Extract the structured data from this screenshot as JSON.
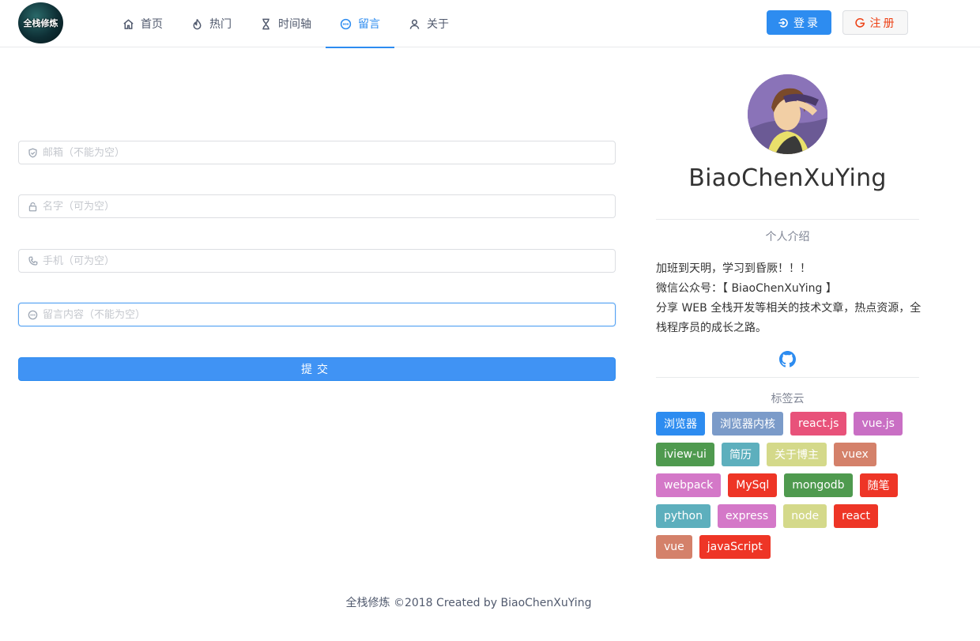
{
  "header": {
    "logo_text": "全栈修炼",
    "nav": [
      {
        "label": "首页",
        "icon": "home-icon"
      },
      {
        "label": "热门",
        "icon": "flame-icon"
      },
      {
        "label": "时间轴",
        "icon": "hourglass-icon"
      },
      {
        "label": "留言",
        "icon": "message-icon",
        "active": true
      },
      {
        "label": "关于",
        "icon": "user-icon"
      }
    ],
    "login_label": "登录",
    "register_label": "注册"
  },
  "form": {
    "email_placeholder": "邮箱（不能为空）",
    "name_placeholder": "名字（可为空）",
    "phone_placeholder": "手机（可为空）",
    "message_placeholder": "留言内容（不能为空）",
    "submit_label": "提交"
  },
  "profile": {
    "name": "BiaoChenXuYing",
    "intro_title": "个人介绍",
    "intro_lines": [
      "加班到天明，学习到昏厥！！！",
      "微信公众号：【 BiaoChenXuYing 】",
      "分享 WEB 全栈开发等相关的技术文章，热点资源，全栈程序员的成长之路。"
    ],
    "tags_title": "标签云",
    "tags": [
      {
        "label": "浏览器",
        "color": "#2d8cf0"
      },
      {
        "label": "浏览器内核",
        "color": "#7b9bc9"
      },
      {
        "label": "react.js",
        "color": "#e8527a"
      },
      {
        "label": "vue.js",
        "color": "#c96fc4"
      },
      {
        "label": "iview-ui",
        "color": "#4f9a4f"
      },
      {
        "label": "简历",
        "color": "#5dafbd"
      },
      {
        "label": "关于博主",
        "color": "#d4d98a"
      },
      {
        "label": "vuex",
        "color": "#d4816a"
      },
      {
        "label": "webpack",
        "color": "#d478c8"
      },
      {
        "label": "MySql",
        "color": "#ee3526"
      },
      {
        "label": "mongodb",
        "color": "#4f9a4f"
      },
      {
        "label": "随笔",
        "color": "#ee3526"
      },
      {
        "label": "python",
        "color": "#5dafbd"
      },
      {
        "label": "express",
        "color": "#d478c8"
      },
      {
        "label": "node",
        "color": "#d4d98a"
      },
      {
        "label": "react",
        "color": "#ee3526"
      },
      {
        "label": "vue",
        "color": "#d4816a"
      },
      {
        "label": "javaScript",
        "color": "#ee3526"
      }
    ]
  },
  "footer": {
    "text": "全栈修炼 ©2018 Created by BiaoChenXuYing"
  },
  "colors": {
    "primary": "#2d8cf0",
    "danger": "#ed4014"
  }
}
